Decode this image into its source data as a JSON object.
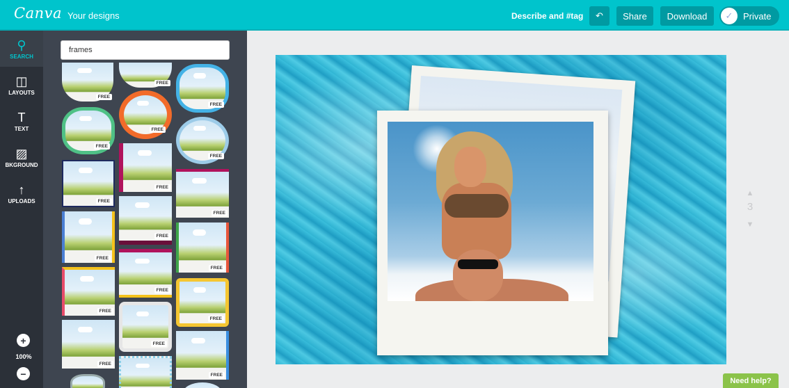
{
  "header": {
    "logo": "Canva",
    "your_designs": "Your designs",
    "describe": "Describe and #tag",
    "undo_icon": "↶",
    "share_label": "Share",
    "download_label": "Download",
    "private_label": "Private",
    "private_check": "✓"
  },
  "rail": {
    "items": [
      {
        "label": "SEARCH",
        "icon": "⚲"
      },
      {
        "label": "LAYOUTS",
        "icon": "◫"
      },
      {
        "label": "TEXT",
        "icon": "T"
      },
      {
        "label": "BKGROUND",
        "icon": "▨"
      },
      {
        "label": "UPLOADS",
        "icon": "↑"
      }
    ],
    "zoom_in": "+",
    "zoom_level": "100%",
    "zoom_out": "−"
  },
  "panel": {
    "search_value": "frames",
    "free_badge": "FREE"
  },
  "page_nav": {
    "up": "▲",
    "page_number": "3",
    "down": "▼"
  },
  "help": {
    "label": "Need help?"
  },
  "colors": {
    "brand": "#00c4cc",
    "rail": "#2b3038",
    "panel": "#3e4550",
    "help": "#8bc34a"
  }
}
